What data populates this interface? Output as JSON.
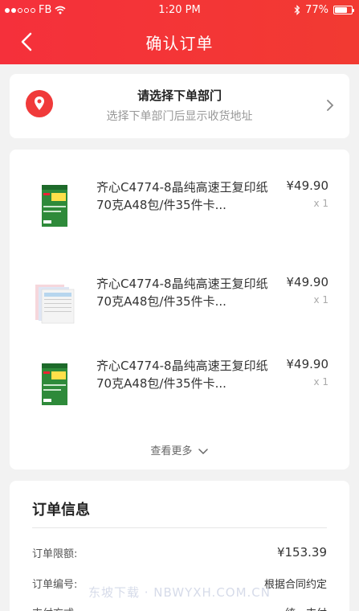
{
  "status_bar": {
    "carrier": "FB",
    "time": "1:20 PM",
    "battery": "77%",
    "battery_level": 0.77
  },
  "nav": {
    "title": "确认订单",
    "back_icon": "chevron-left-icon"
  },
  "department": {
    "title": "请选择下单部门",
    "subtitle": "选择下单部门后显示收货地址",
    "icon": "location-pin-icon",
    "arrow_icon": "chevron-right-icon"
  },
  "goods": {
    "items": [
      {
        "title": "齐心C4774-8晶纯高速王复印纸70克A48包/件35件卡...",
        "price": "¥49.90",
        "qty": "x 1",
        "thumb": "paper-box-green"
      },
      {
        "title": "齐心C4774-8晶纯高速王复印纸70克A48包/件35件卡...",
        "price": "¥49.90",
        "qty": "x 1",
        "thumb": "multi-part-forms"
      },
      {
        "title": "齐心C4774-8晶纯高速王复印纸70克A48包/件35件卡...",
        "price": "¥49.90",
        "qty": "x 1",
        "thumb": "paper-box-green"
      }
    ],
    "more_label": "查看更多"
  },
  "order_info": {
    "title": "订单信息",
    "rows": [
      {
        "label": "订单限额:",
        "value": "¥153.39"
      },
      {
        "label": "订单编号:",
        "value": "根据合同约定"
      },
      {
        "label": "支付方式",
        "value": "统一支付"
      }
    ]
  },
  "watermark": "东坡下载 · NBWYXH.COM.CN",
  "colors": {
    "brand": "#f23a32",
    "background": "#f2f2f2"
  }
}
